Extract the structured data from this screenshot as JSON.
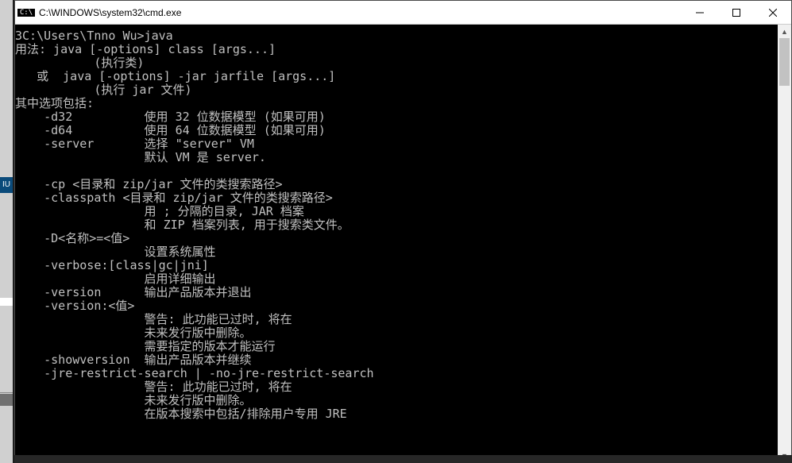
{
  "titlebar": {
    "icon_label": "C:\\",
    "title": "C:\\WINDOWS\\system32\\cmd.exe"
  },
  "left_badge": "IU",
  "terminal": {
    "lines": [
      "3C:\\Users\\Tnno Wu>java",
      "用法: java [-options] class [args...]",
      "           (执行类)",
      "   或  java [-options] -jar jarfile [args...]",
      "           (执行 jar 文件)",
      "其中选项包括:",
      "    -d32          使用 32 位数据模型 (如果可用)",
      "    -d64          使用 64 位数据模型 (如果可用)",
      "    -server       选择 \"server\" VM",
      "                  默认 VM 是 server.",
      "",
      "    -cp <目录和 zip/jar 文件的类搜索路径>",
      "    -classpath <目录和 zip/jar 文件的类搜索路径>",
      "                  用 ; 分隔的目录, JAR 档案",
      "                  和 ZIP 档案列表, 用于搜索类文件。",
      "    -D<名称>=<值>",
      "                  设置系统属性",
      "    -verbose:[class|gc|jni]",
      "                  启用详细输出",
      "    -version      输出产品版本并退出",
      "    -version:<值>",
      "                  警告: 此功能已过时, 将在",
      "                  未来发行版中删除。",
      "                  需要指定的版本才能运行",
      "    -showversion  输出产品版本并继续",
      "    -jre-restrict-search | -no-jre-restrict-search",
      "                  警告: 此功能已过时, 将在",
      "                  未来发行版中删除。",
      "                  在版本搜索中包括/排除用户专用 JRE"
    ]
  }
}
